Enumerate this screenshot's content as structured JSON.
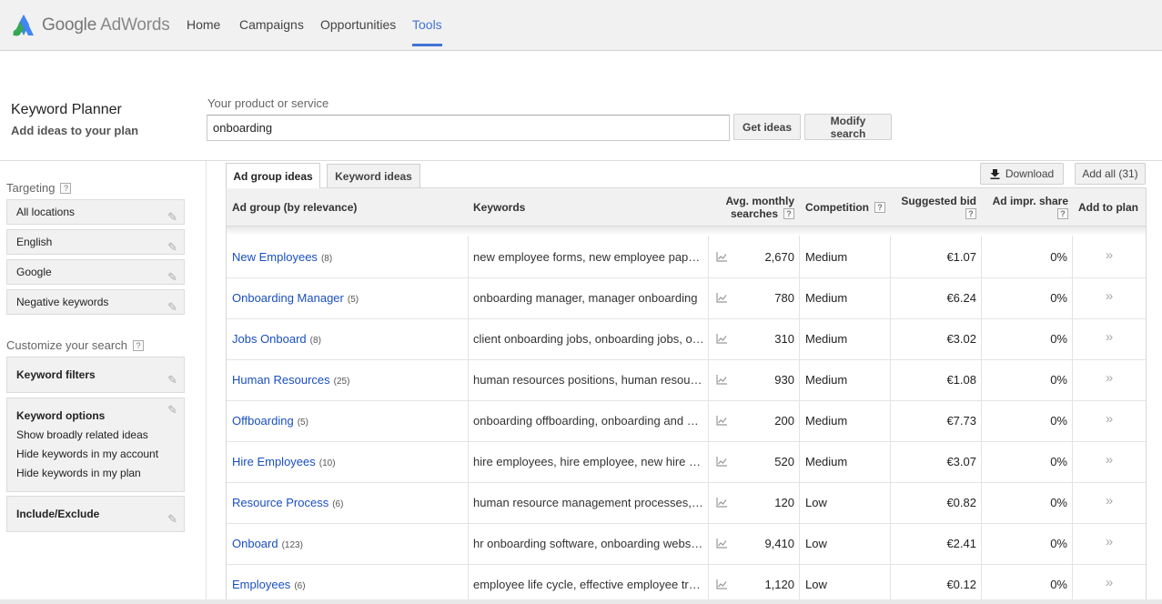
{
  "header": {
    "logo_google": "Google",
    "logo_adwords": "AdWords",
    "nav": [
      {
        "label": "Home",
        "active": false
      },
      {
        "label": "Campaigns",
        "active": false
      },
      {
        "label": "Opportunities",
        "active": false
      },
      {
        "label": "Tools",
        "active": true
      }
    ],
    "accent_color": "#4273d8"
  },
  "page": {
    "title": "Keyword Planner",
    "subtitle": "Add ideas to your plan",
    "product_label": "Your product or service",
    "product_value": "onboarding",
    "get_ideas": "Get ideas",
    "modify_search": "Modify search"
  },
  "sidebar": {
    "targeting_label": "Targeting",
    "targeting_items": [
      "All locations",
      "English",
      "Google",
      "Negative keywords"
    ],
    "customize_label": "Customize your search",
    "keyword_filters": "Keyword filters",
    "keyword_options": "Keyword options",
    "keyword_options_lines": [
      "Show broadly related ideas",
      "Hide keywords in my account",
      "Hide keywords in my plan"
    ],
    "include_exclude": "Include/Exclude",
    "help_glyph": "?"
  },
  "tabs": {
    "ad_group_ideas": "Ad group ideas",
    "keyword_ideas": "Keyword ideas",
    "download": "Download",
    "add_all": "Add all (31)"
  },
  "table": {
    "headers": {
      "ad_group": "Ad group (by relevance)",
      "keywords": "Keywords",
      "avg_monthly_1": "Avg. monthly",
      "avg_monthly_2": "searches",
      "competition": "Competition",
      "suggested_bid": "Suggested bid",
      "ad_impr_share": "Ad impr. share",
      "add_to_plan": "Add to plan"
    },
    "rows": [
      {
        "name": "New Employees",
        "count": "(8)",
        "keywords": "new employee forms, new employee paperwork",
        "searches": "2,670",
        "competition": "Medium",
        "bid": "€1.07",
        "share": "0%"
      },
      {
        "name": "Onboarding Manager",
        "count": "(5)",
        "keywords": "onboarding manager, manager onboarding",
        "searches": "780",
        "competition": "Medium",
        "bid": "€6.24",
        "share": "0%"
      },
      {
        "name": "Jobs Onboard",
        "count": "(8)",
        "keywords": "client onboarding jobs, onboarding jobs, onboard",
        "searches": "310",
        "competition": "Medium",
        "bid": "€3.02",
        "share": "0%"
      },
      {
        "name": "Human Resources",
        "count": "(25)",
        "keywords": "human resources positions, human resources",
        "searches": "930",
        "competition": "Medium",
        "bid": "€1.08",
        "share": "0%"
      },
      {
        "name": "Offboarding",
        "count": "(5)",
        "keywords": "onboarding offboarding, onboarding and offboarding",
        "searches": "200",
        "competition": "Medium",
        "bid": "€7.73",
        "share": "0%"
      },
      {
        "name": "Hire Employees",
        "count": "(10)",
        "keywords": "hire employees, hire employee, new hire employees",
        "searches": "520",
        "competition": "Medium",
        "bid": "€3.07",
        "share": "0%"
      },
      {
        "name": "Resource Process",
        "count": "(6)",
        "keywords": "human resource management processes, hr",
        "searches": "120",
        "competition": "Low",
        "bid": "€0.82",
        "share": "0%"
      },
      {
        "name": "Onboard",
        "count": "(123)",
        "keywords": "hr onboarding software, onboarding websites",
        "searches": "9,410",
        "competition": "Low",
        "bid": "€2.41",
        "share": "0%"
      },
      {
        "name": "Employees",
        "count": "(6)",
        "keywords": "employee life cycle, effective employee training",
        "searches": "1,120",
        "competition": "Low",
        "bid": "€0.12",
        "share": "0%"
      }
    ],
    "trend_icon": "trend-chart-icon",
    "add_icon": "double-chevron-right-icon"
  }
}
